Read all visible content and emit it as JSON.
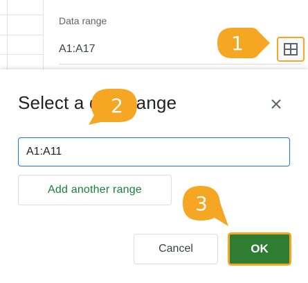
{
  "side_panel": {
    "label": "Data range",
    "range_value": "A1:A17",
    "select_icon": "grid-icon"
  },
  "dialog": {
    "title": "Select a data range",
    "close_icon": "close-icon",
    "input_value": "A1:A11",
    "add_range_label": "Add another range",
    "cancel_label": "Cancel",
    "ok_label": "OK"
  },
  "callouts": [
    {
      "label": "1"
    },
    {
      "label": "2"
    },
    {
      "label": "3"
    }
  ],
  "colors": {
    "accent_callout": "#f5a623",
    "ok_button": "#2e7d32",
    "link_green": "#188038",
    "focus_blue": "#1a73e8"
  }
}
